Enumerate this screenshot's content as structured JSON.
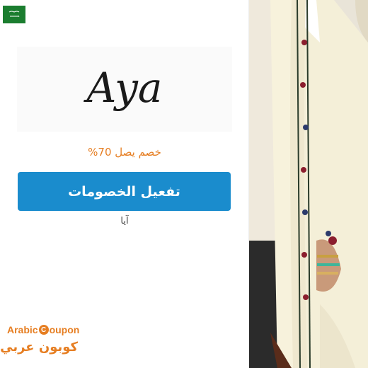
{
  "flag": {
    "icon": "saudi-flag-icon",
    "color": "#1b7d2f"
  },
  "brand": {
    "logo_text": "Aya",
    "name_ar": "آيا"
  },
  "offer": {
    "discount_text": "خصم يصل 70%",
    "button_label": "تفعيل الخصومات"
  },
  "site": {
    "name_en_part1": "Arabic ",
    "name_en_circle": "C",
    "name_en_part2": "oupon",
    "name_ar": "كوبون عربي"
  },
  "colors": {
    "accent": "#e67e22",
    "button": "#1a8ccd"
  },
  "photo": {
    "icon": "model-embroidered-abaya-photo"
  }
}
